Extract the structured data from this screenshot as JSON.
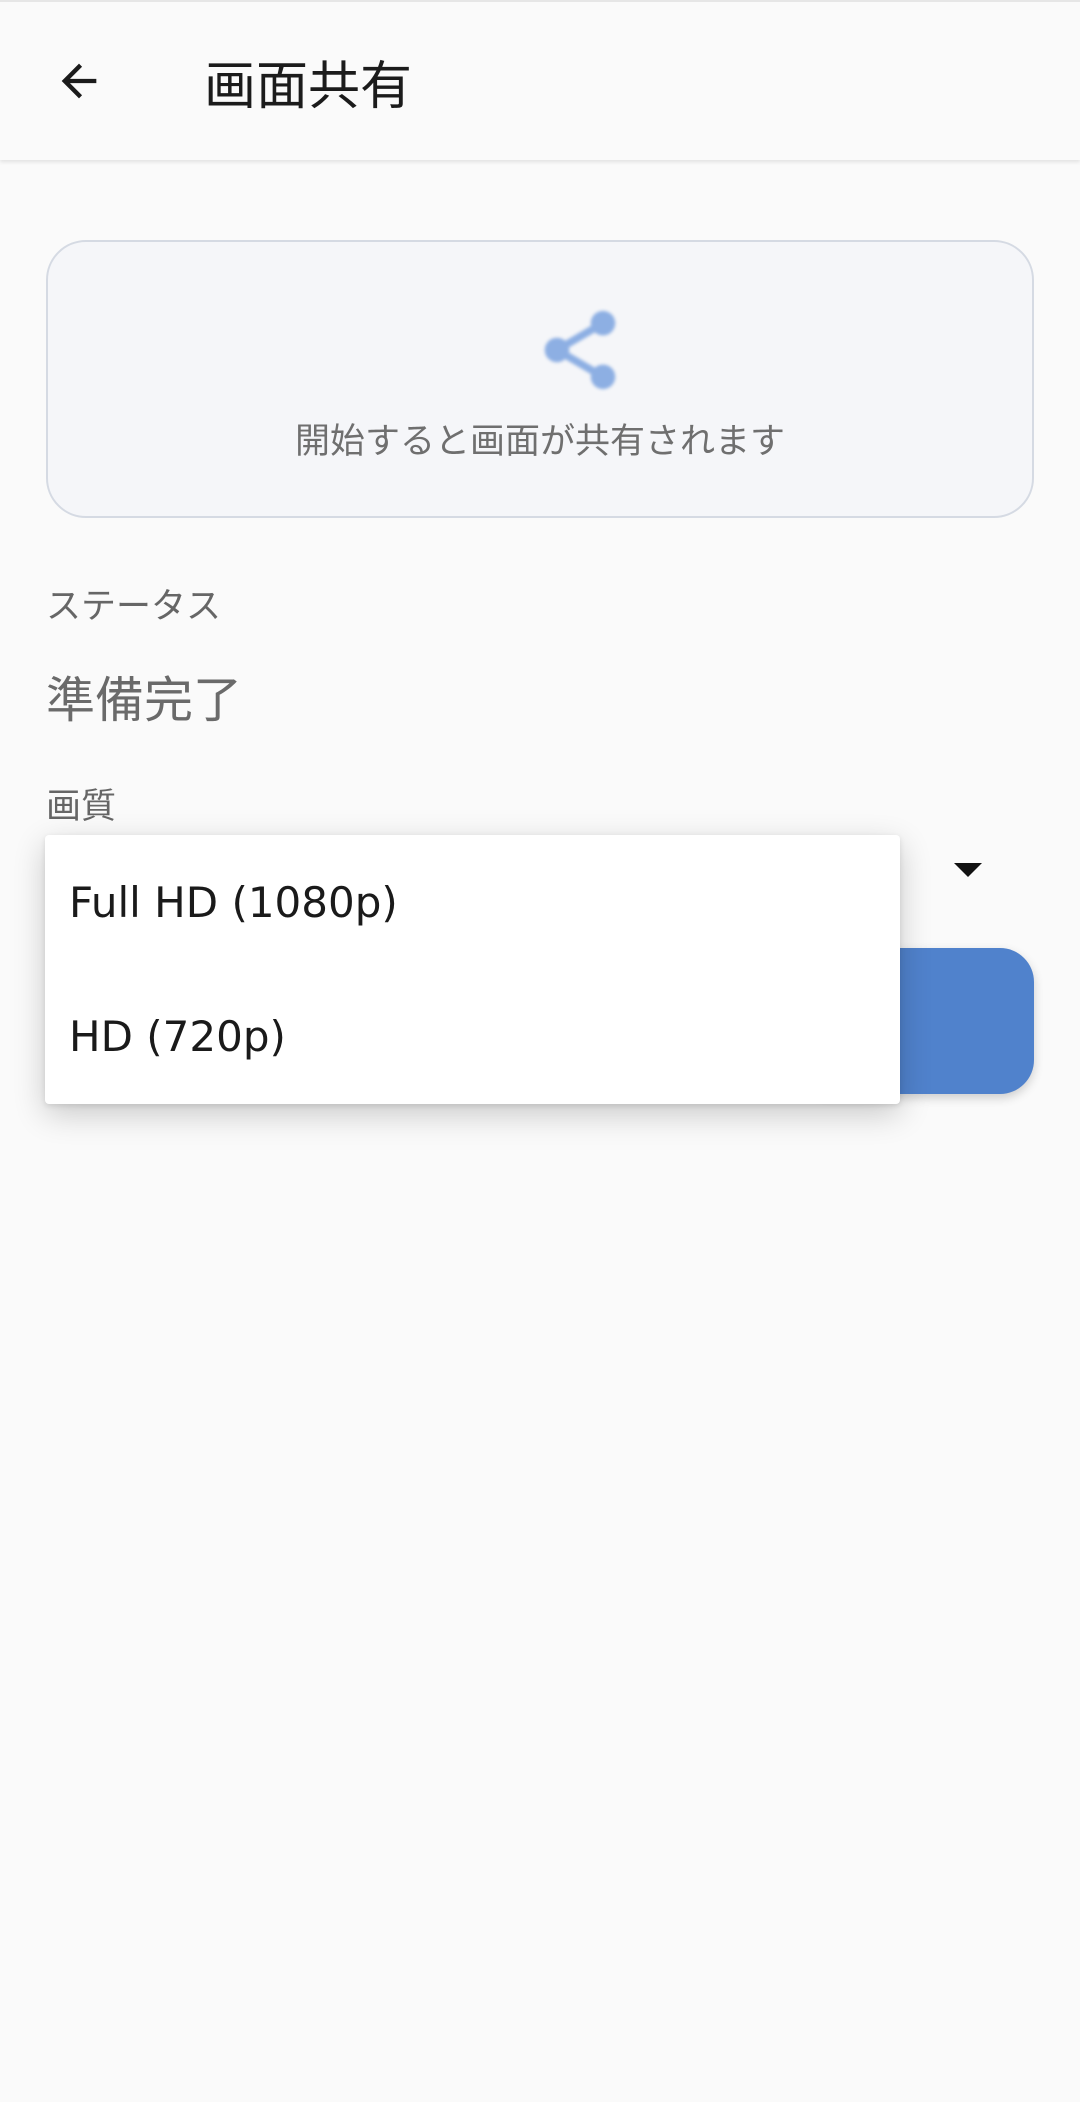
{
  "app_bar": {
    "title": "画面共有",
    "back_icon": "arrow-left-icon"
  },
  "preview": {
    "icon": "share-icon",
    "icon_color": "#8dafe3",
    "message": "開始すると画面が共有されます"
  },
  "status": {
    "label": "ステータス",
    "value": "準備完了"
  },
  "quality": {
    "label": "画質",
    "options": [
      "Full HD (1080p)",
      "HD (720p)"
    ]
  },
  "colors": {
    "accent": "#5082cc",
    "background": "#fafafa"
  }
}
